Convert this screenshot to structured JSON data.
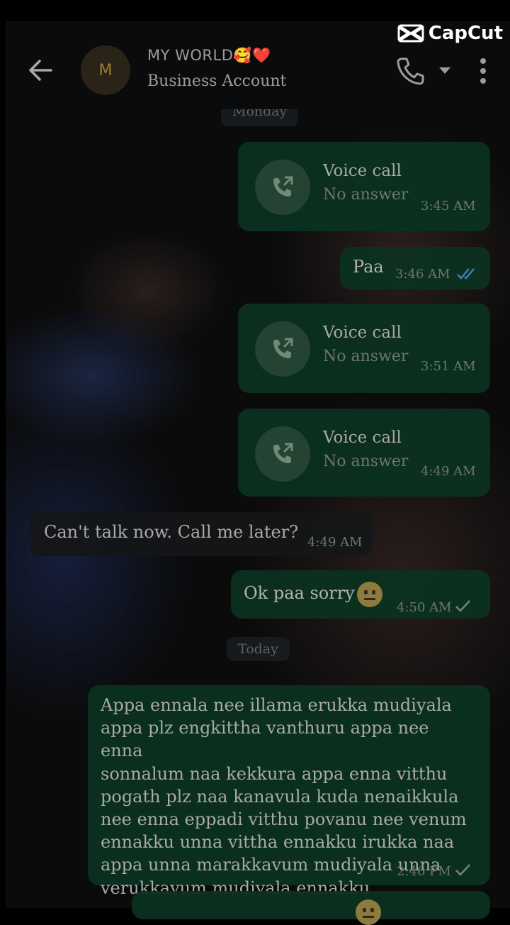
{
  "watermark": {
    "text": "CapCut",
    "icon": "capcut-logo-icon"
  },
  "header": {
    "avatar_letter": "M",
    "contact_name": "MY WORLD🥰❤️",
    "subtitle": "Business Account",
    "icons": [
      "back-arrow-icon",
      "phone-icon",
      "caret-down-icon",
      "more-vertical-icon"
    ]
  },
  "day_labels": {
    "first": "Monday",
    "second": "Today"
  },
  "messages": [
    {
      "type": "voice_call",
      "direction": "outgoing",
      "title": "Voice call",
      "status": "No answer",
      "time": "3:45 AM"
    },
    {
      "type": "text",
      "direction": "outgoing",
      "text": "Paa",
      "time": "3:46 AM",
      "ticks": "double-read"
    },
    {
      "type": "voice_call",
      "direction": "outgoing",
      "title": "Voice call",
      "status": "No answer",
      "time": "3:51 AM"
    },
    {
      "type": "voice_call",
      "direction": "outgoing",
      "title": "Voice call",
      "status": "No answer",
      "time": "4:49 AM"
    },
    {
      "type": "text",
      "direction": "incoming",
      "text": "Can't talk now. Call me later?",
      "time": "4:49 AM"
    },
    {
      "type": "text",
      "direction": "outgoing",
      "text": "Ok paa sorry",
      "emoji": "neutral-face-icon",
      "time": "4:50 AM",
      "ticks": "single"
    },
    {
      "type": "text",
      "direction": "outgoing",
      "lines": [
        "Appa ennala nee illama erukka mudiyala",
        "appa plz engkittha vanthuru appa nee enna",
        "sonnalum naa kekkura appa enna vitthu",
        "pogath plz naa kanavula kuda nenaikkula",
        "nee enna eppadi vitthu povanu nee venum",
        "ennakku unna vittha ennakku irukka naa",
        "appa unna marakkavum mudiyala unna",
        "verukkavum mudiyala ennakku"
      ],
      "time": "2:46 PM",
      "ticks": "single"
    }
  ],
  "colors": {
    "outgoing_bubble": "#0c3220",
    "incoming_bubble": "#141618",
    "read_tick": "#3b7fb8",
    "header_bg": "#0a0c0e"
  }
}
